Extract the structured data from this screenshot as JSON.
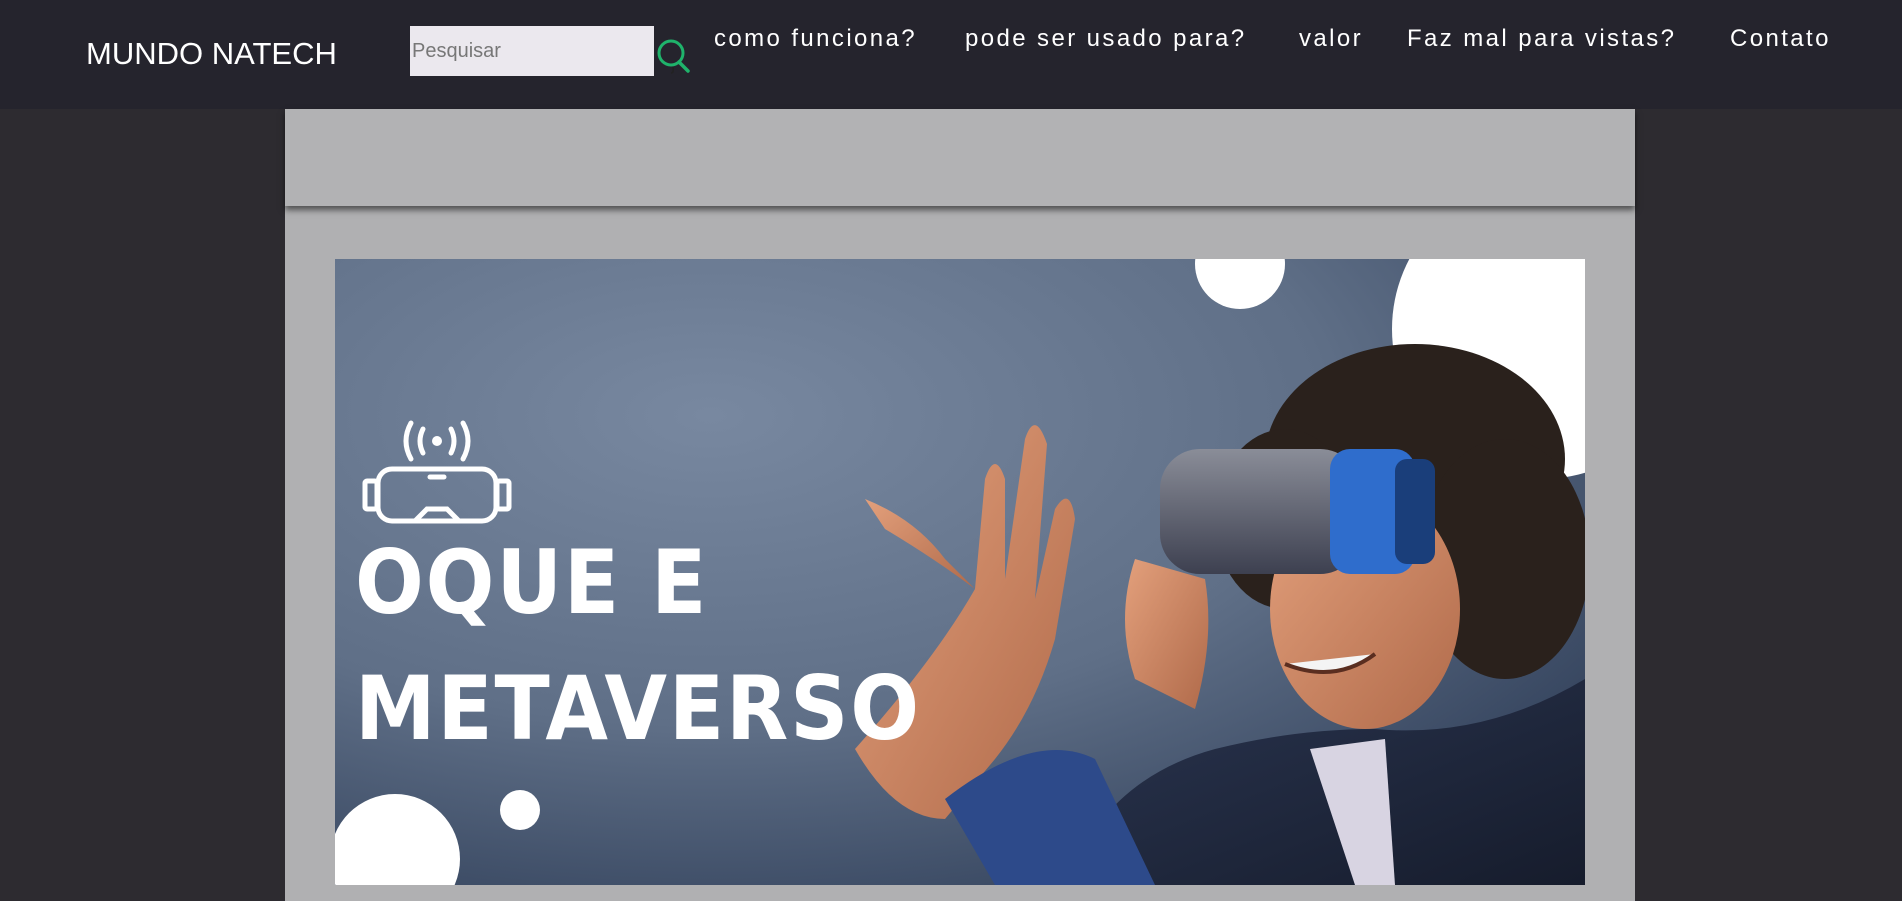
{
  "header": {
    "brand": "MUNDO NATECH",
    "search": {
      "placeholder": "Pesquisar",
      "value": "",
      "icon": "search-icon"
    },
    "nav": [
      {
        "label": "como funciona?"
      },
      {
        "label": "pode ser usado para?"
      },
      {
        "label": "valor"
      },
      {
        "label": "Faz mal para vistas?"
      },
      {
        "label": "Contato"
      }
    ]
  },
  "banner": {
    "line1": "OQUE E",
    "line2": "METAVERSO",
    "icon": "vr-headset-icon"
  },
  "colors": {
    "topbar": "#25242d",
    "page_bg": "#2d2b30",
    "panel": "#b0b0b2",
    "accent": "#1fb36b"
  }
}
